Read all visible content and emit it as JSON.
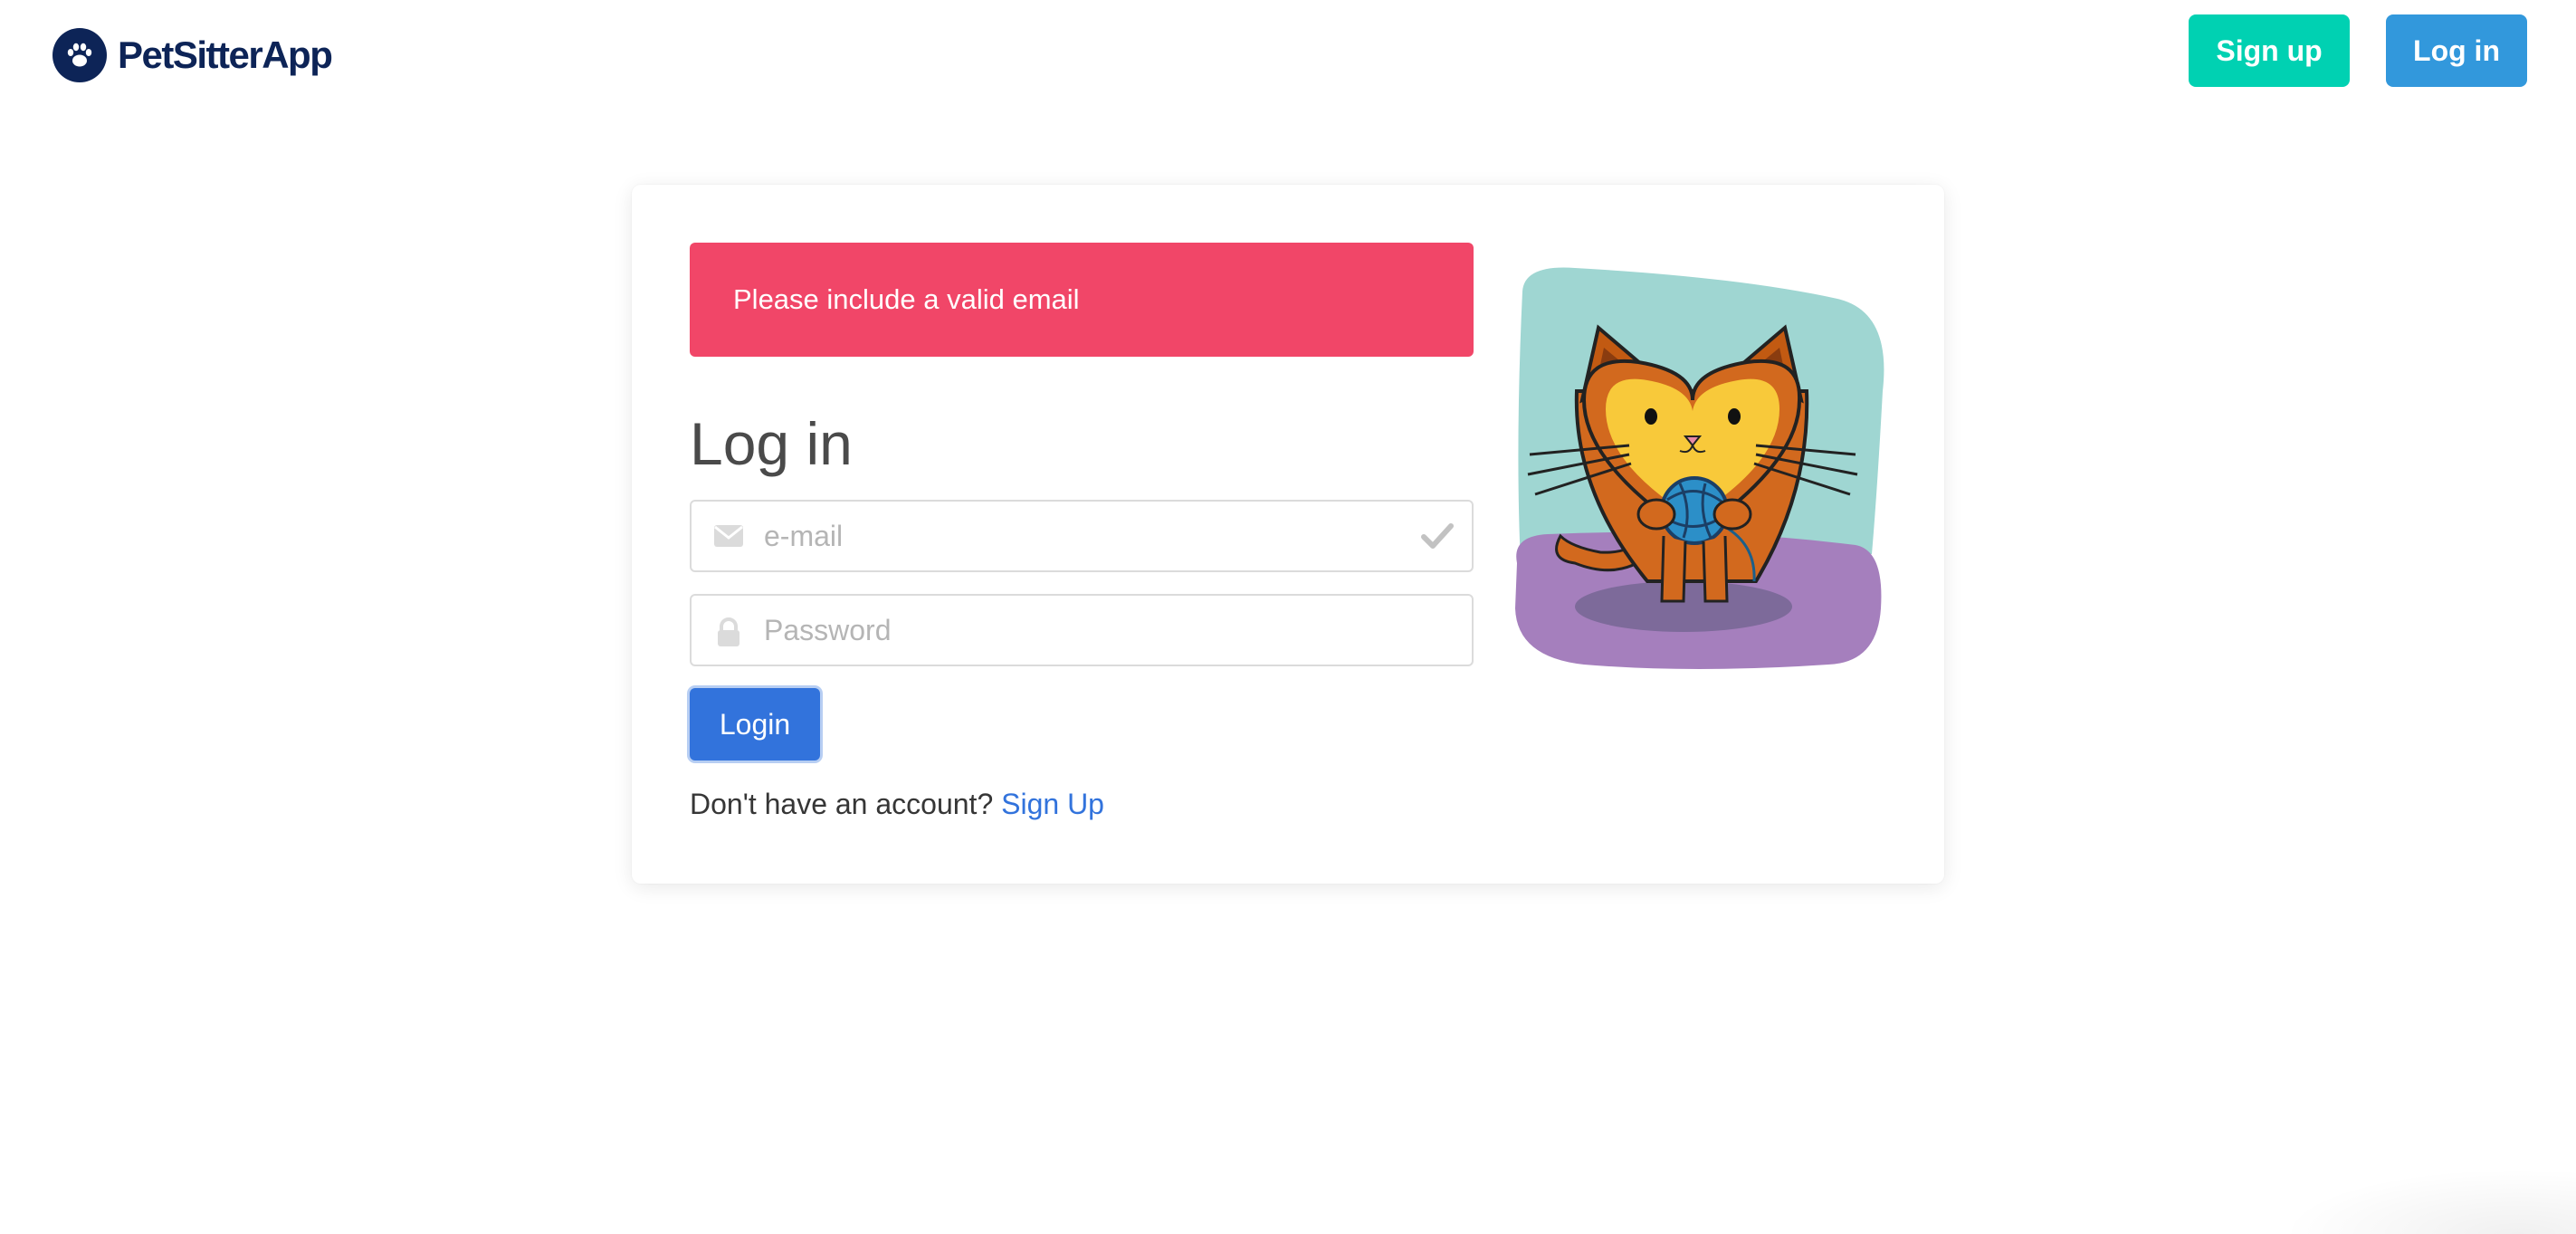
{
  "app": {
    "brand_name": "PetSitterApp",
    "brand_icon": "paw-icon",
    "brand_color": "#0d2457"
  },
  "nav": {
    "signup_label": "Sign up",
    "login_label": "Log in",
    "signup_color": "#00d1b2",
    "login_color": "#3298dc"
  },
  "form": {
    "alert_message": "Please include a valid email",
    "alert_color": "#f14668",
    "title": "Log in",
    "email": {
      "placeholder": "e-mail",
      "value": "",
      "icon": "envelope-icon",
      "status_icon": "check-icon"
    },
    "password": {
      "placeholder": "Password",
      "value": "",
      "icon": "lock-icon"
    },
    "submit_label": "Login",
    "submit_color": "#3273dc",
    "no_account_text": "Don't have an account?",
    "signup_link": "Sign Up"
  },
  "illustration": {
    "subject": "cat-with-yarn-illustration"
  }
}
